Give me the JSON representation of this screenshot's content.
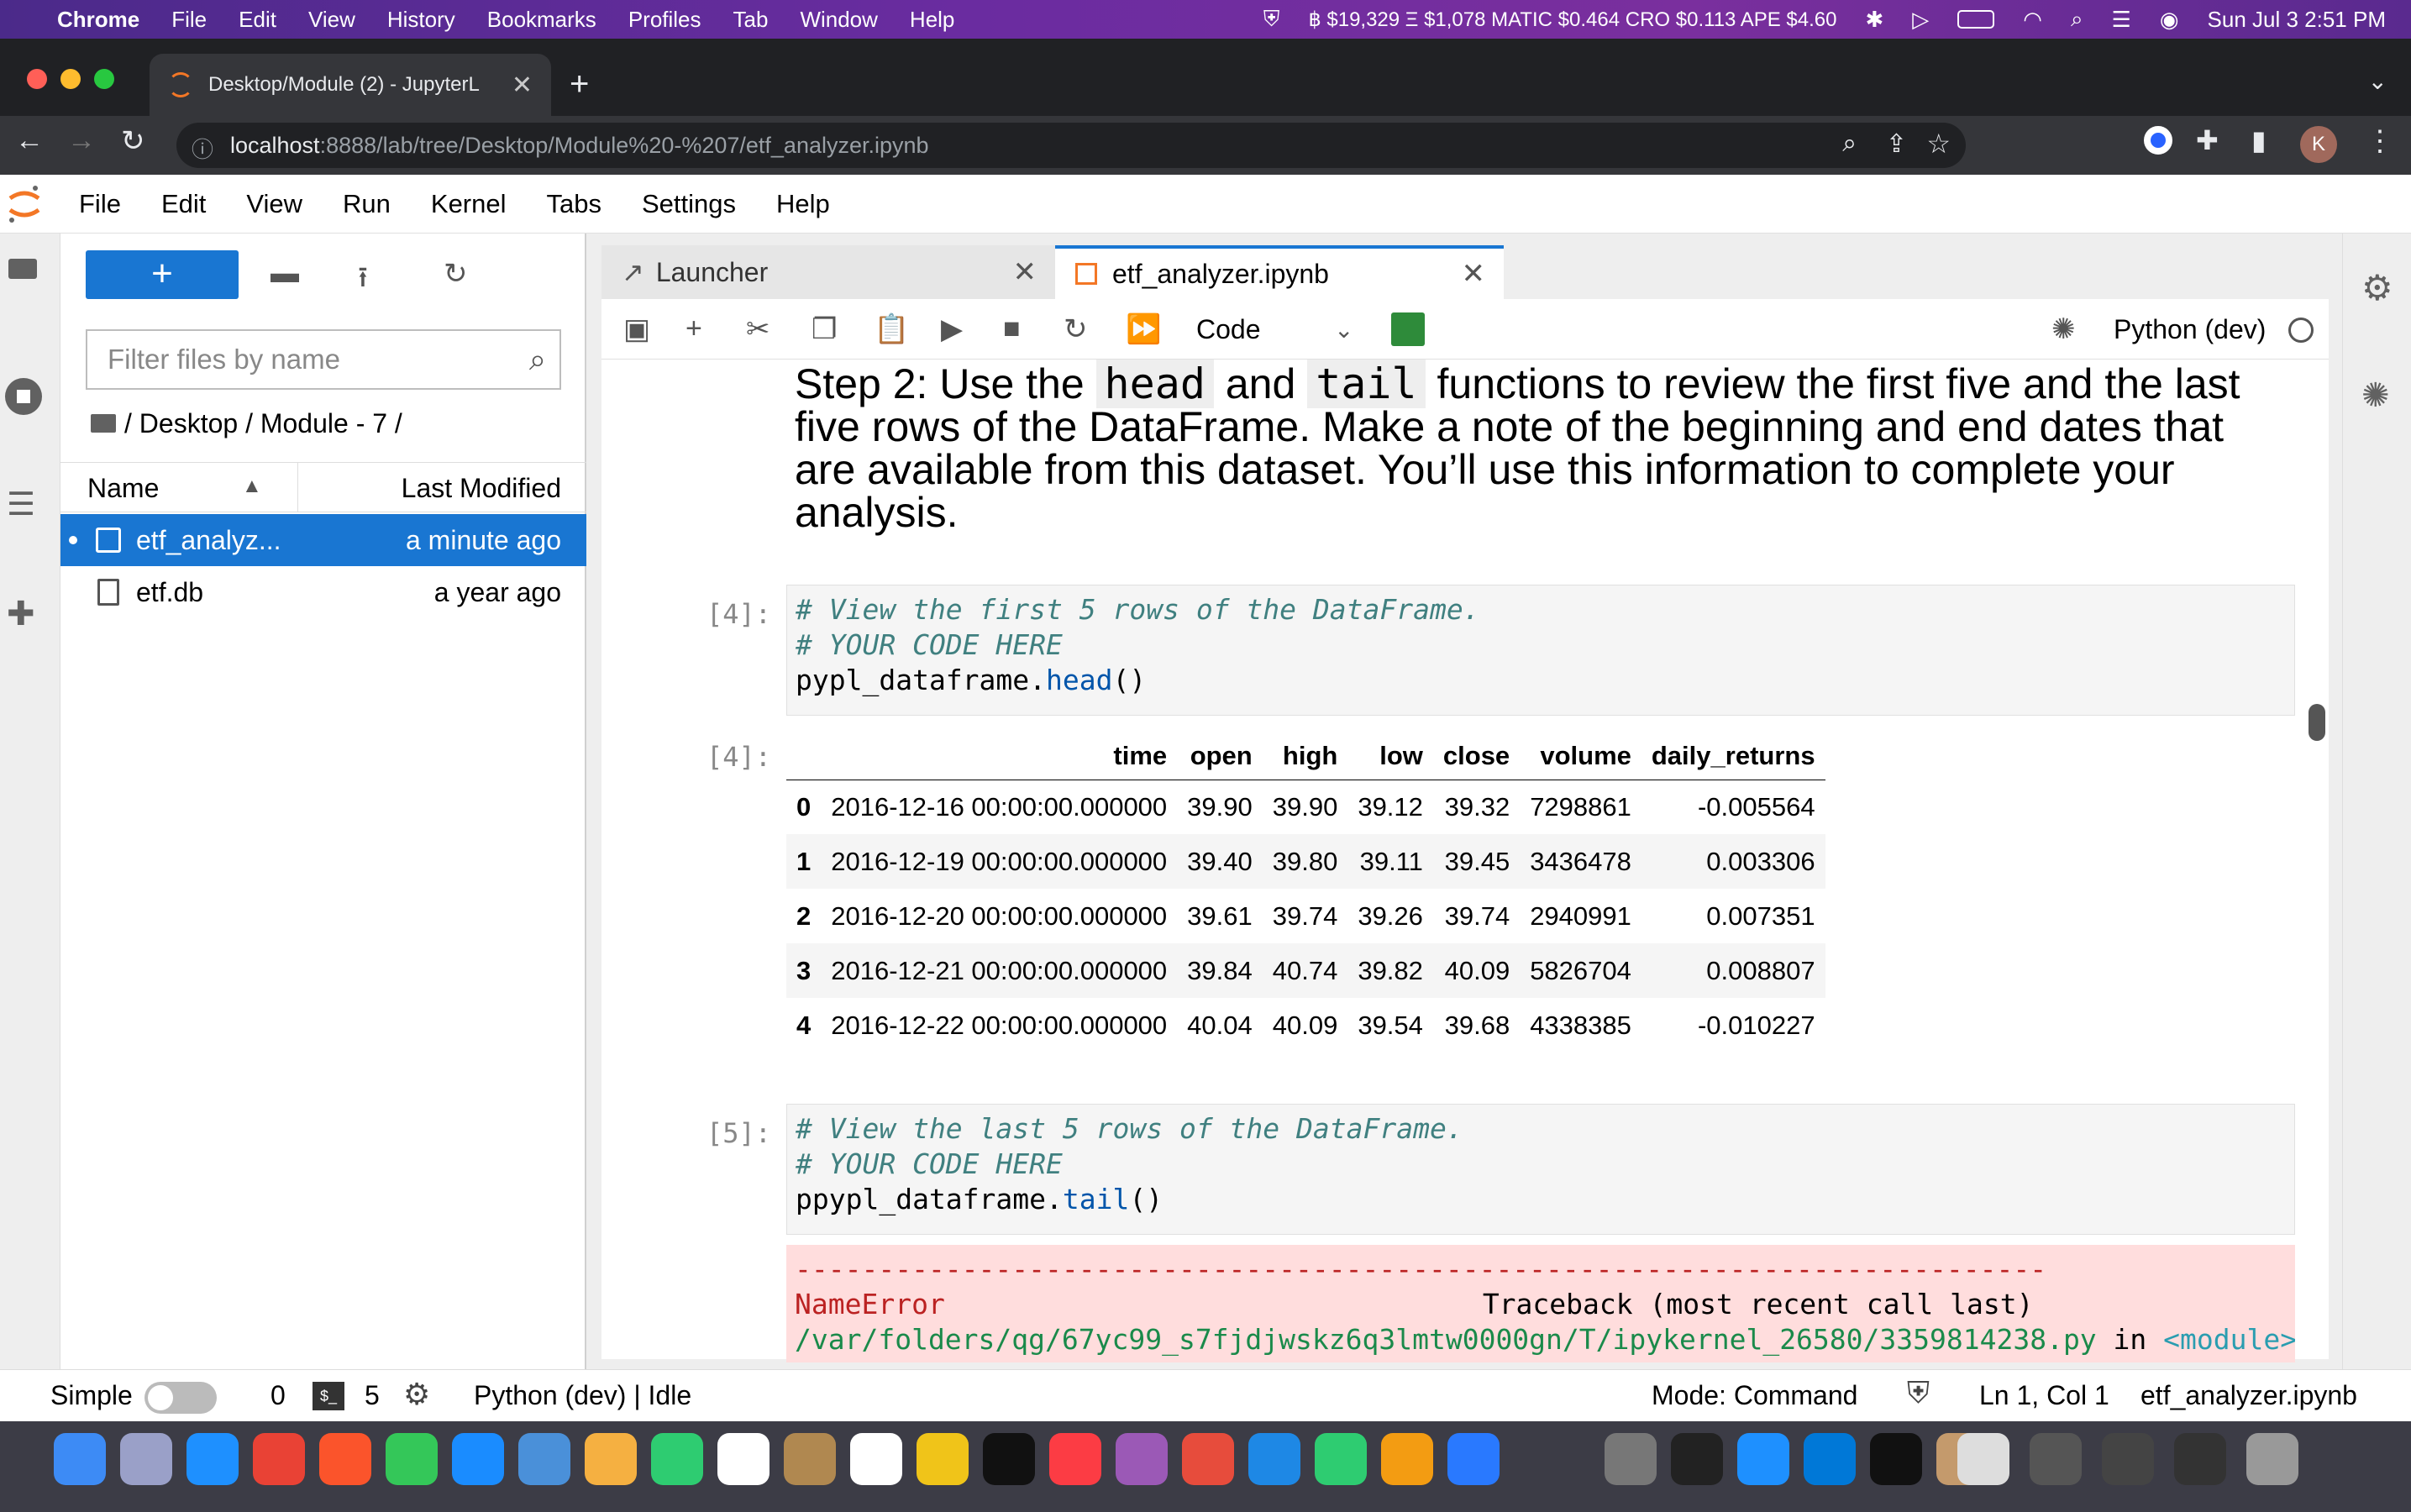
{
  "mac_menubar": {
    "app": "Chrome",
    "items": [
      "File",
      "Edit",
      "View",
      "History",
      "Bookmarks",
      "Profiles",
      "Tab",
      "Window",
      "Help"
    ],
    "ticker": "฿ $19,329 Ξ $1,078 MATIC $0.464 CRO $0.113 APE $4.60",
    "datetime": "Sun Jul 3  2:51 PM"
  },
  "browser": {
    "tab_title": "Desktop/Module (2) - JupyterL",
    "url_host": "localhost",
    "url_path": ":8888/lab/tree/Desktop/Module%20-%207/etf_analyzer.ipynb",
    "profile_initial": "K"
  },
  "jupyter_menu": [
    "File",
    "Edit",
    "View",
    "Run",
    "Kernel",
    "Tabs",
    "Settings",
    "Help"
  ],
  "file_browser": {
    "new_label": "+",
    "filter_placeholder": "Filter files by name",
    "breadcrumb": "/ Desktop / Module - 7 /",
    "col_name": "Name",
    "col_modified": "Last Modified",
    "files": [
      {
        "name": "etf_analyz...",
        "modified": "a minute ago"
      },
      {
        "name": "etf.db",
        "modified": "a year ago"
      }
    ]
  },
  "doc_tabs": [
    {
      "label": "Launcher"
    },
    {
      "label": "etf_analyzer.ipynb"
    }
  ],
  "toolbar": {
    "cell_type": "Code",
    "kernel": "Python (dev)"
  },
  "notebook": {
    "md_part1": "Step 2: Use the ",
    "md_code1": "head",
    "md_part2": " and ",
    "md_code2": "tail",
    "md_part3": " functions to review the first five and the last five rows of the DataFrame. Make a note of the beginning and end dates that are available from this dataset. You’ll use this information to complete your analysis.",
    "cell4_prompt": "[4]:",
    "cell4_line1": "# View the first 5 rows of the DataFrame.",
    "cell4_line2": "# YOUR CODE HERE",
    "cell4_line3a": "pypl_dataframe.",
    "cell4_line3b": "head",
    "cell4_line3c": "()",
    "out4_prompt": "[4]:",
    "table": {
      "columns": [
        "",
        "time",
        "open",
        "high",
        "low",
        "close",
        "volume",
        "daily_returns"
      ],
      "rows": [
        [
          "0",
          "2016-12-16 00:00:00.000000",
          "39.90",
          "39.90",
          "39.12",
          "39.32",
          "7298861",
          "-0.005564"
        ],
        [
          "1",
          "2016-12-19 00:00:00.000000",
          "39.40",
          "39.80",
          "39.11",
          "39.45",
          "3436478",
          "0.003306"
        ],
        [
          "2",
          "2016-12-20 00:00:00.000000",
          "39.61",
          "39.74",
          "39.26",
          "39.74",
          "2940991",
          "0.007351"
        ],
        [
          "3",
          "2016-12-21 00:00:00.000000",
          "39.84",
          "40.74",
          "39.82",
          "40.09",
          "5826704",
          "0.008807"
        ],
        [
          "4",
          "2016-12-22 00:00:00.000000",
          "40.04",
          "40.09",
          "39.54",
          "39.68",
          "4338385",
          "-0.010227"
        ]
      ]
    },
    "cell5_prompt": "[5]:",
    "cell5_line1": "# View the last 5 rows of the DataFrame.",
    "cell5_line2": "# YOUR CODE HERE",
    "cell5_line3a": "ppypl_dataframe.",
    "cell5_line3b": "tail",
    "cell5_line3c": "()",
    "err_dashes": "---------------------------------------------------------------------------",
    "err_name": "NameError",
    "err_traceback": "Traceback (most recent call last)",
    "err_path": "/var/folders/qg/67yc99_s7fjdjwskz6q3lmtw0000gn/T/ipykernel_26580/3359814238.py",
    "err_in": " in ",
    "err_module": "<module>"
  },
  "statusbar": {
    "mode_label": "Simple",
    "count1": "0",
    "count2": "5",
    "kernel_status": "Python (dev) | Idle",
    "mode": "Mode: Command",
    "position": "Ln 1, Col 1",
    "filename": "etf_analyzer.ipynb"
  },
  "colors": {
    "accent": "#1976d2",
    "error_bg": "#ffdddd",
    "menubar_purple": "#6a2ca0"
  }
}
